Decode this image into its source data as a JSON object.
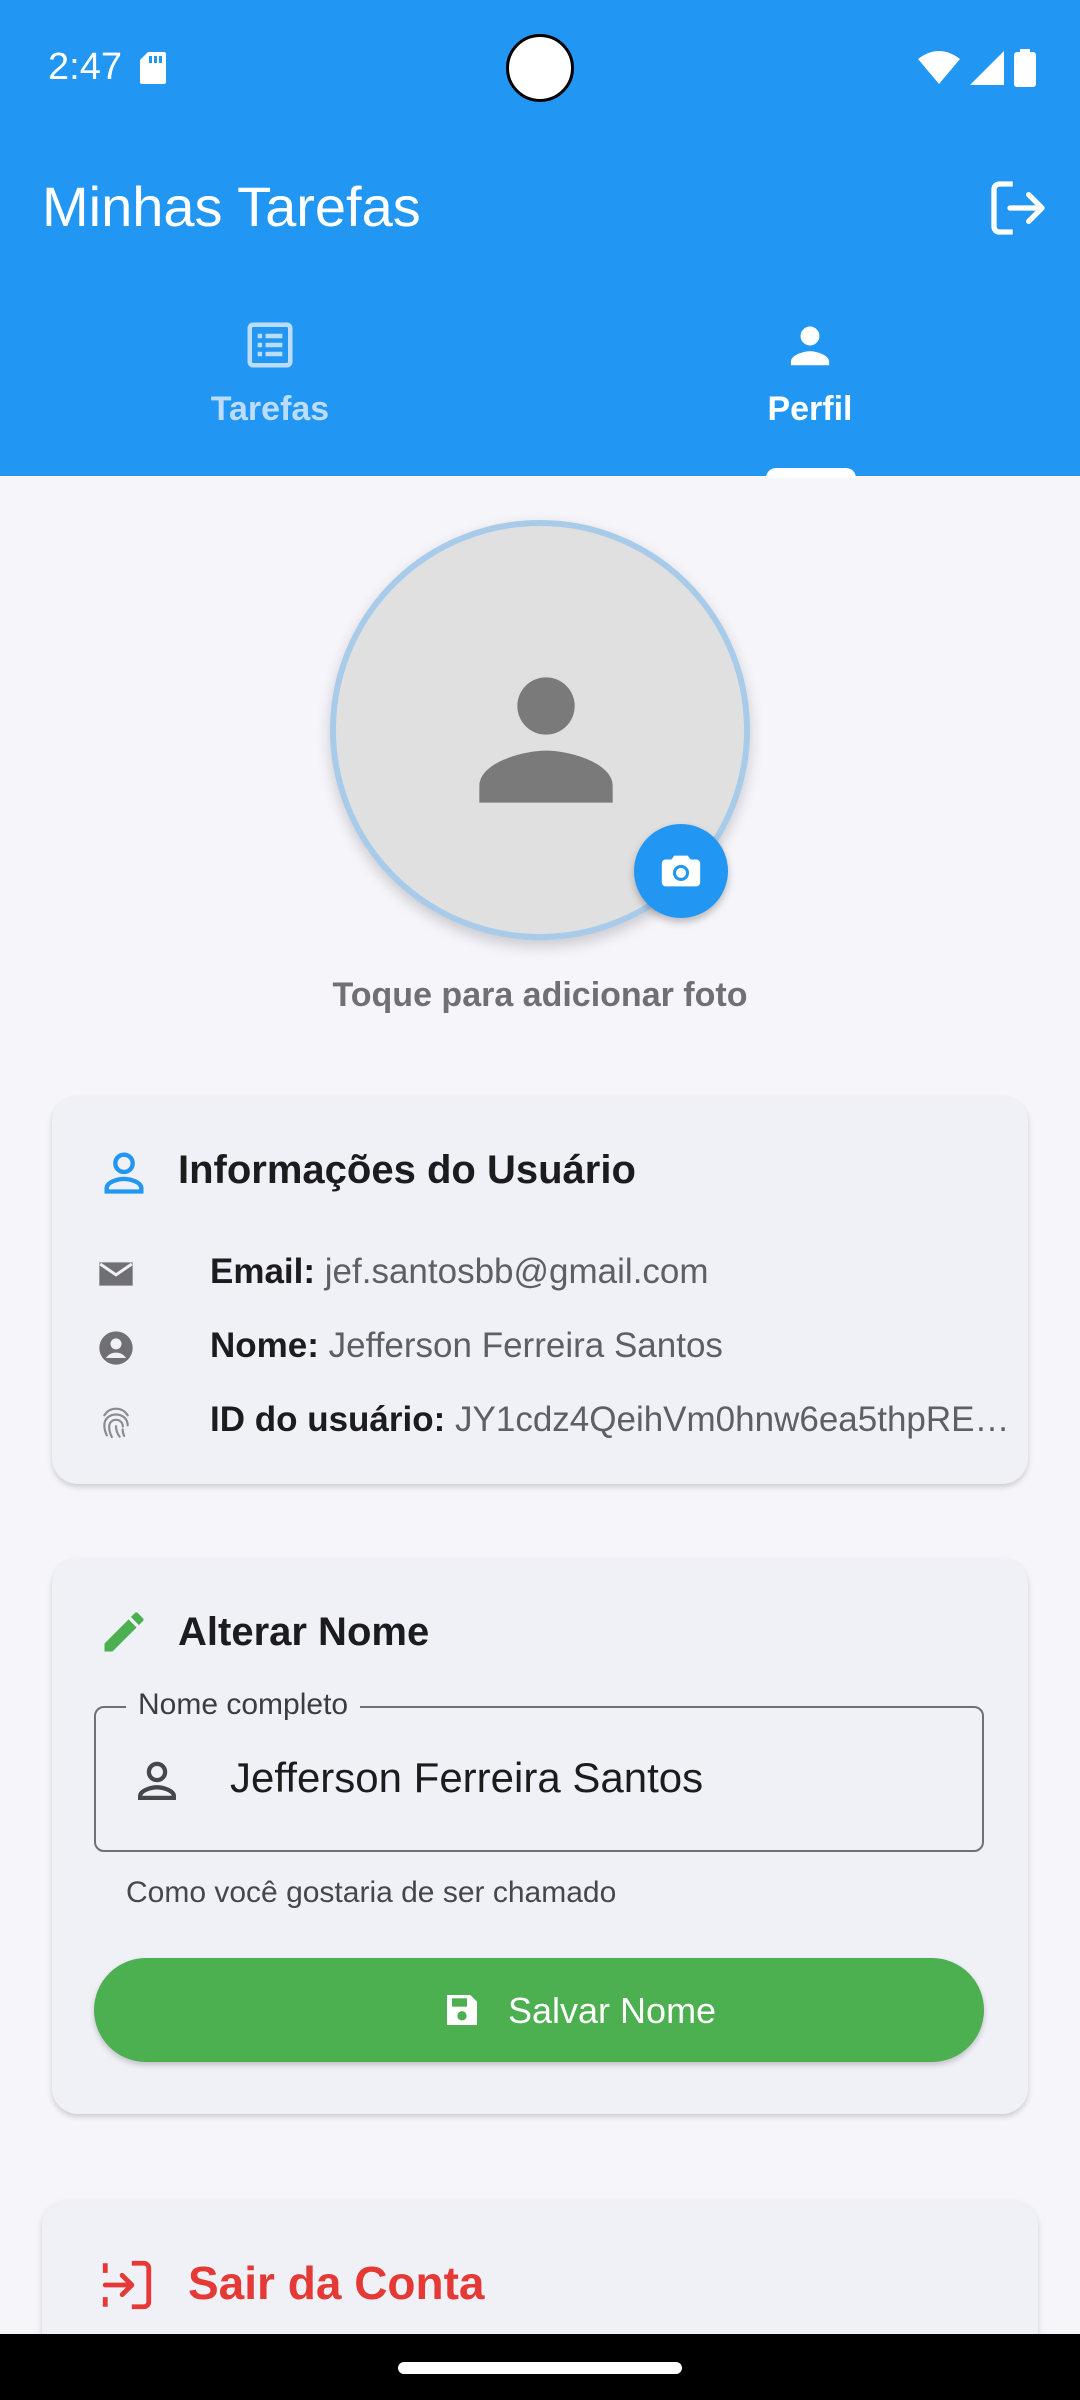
{
  "status_bar": {
    "time": "2:47"
  },
  "app_bar": {
    "title": "Minhas Tarefas"
  },
  "tabs": [
    {
      "label": "Tarefas",
      "icon": "list-alt-icon",
      "selected": false
    },
    {
      "label": "Perfil",
      "icon": "person-icon",
      "selected": true
    }
  ],
  "avatar": {
    "hint": "Toque para adicionar foto"
  },
  "user_info": {
    "title": "Informações do Usuário",
    "email_label": "Email:",
    "email": "jef.santosbb@gmail.com",
    "name_label": "Nome:",
    "name": "Jefferson Ferreira Santos",
    "id_label": "ID do usuário:",
    "id": "JY1cdz4QeihVm0hnw6ea5thpRE…"
  },
  "change_name": {
    "title": "Alterar Nome",
    "field_label": "Nome completo",
    "field_value": "Jefferson Ferreira Santos",
    "helper": "Como você gostaria de ser chamado",
    "save_label": "Salvar Nome"
  },
  "logout_card": {
    "label": "Sair da Conta"
  },
  "colors": {
    "primary": "#2196F3",
    "success": "#4CAF50",
    "danger": "#E53935",
    "background": "#F5F5FA"
  }
}
